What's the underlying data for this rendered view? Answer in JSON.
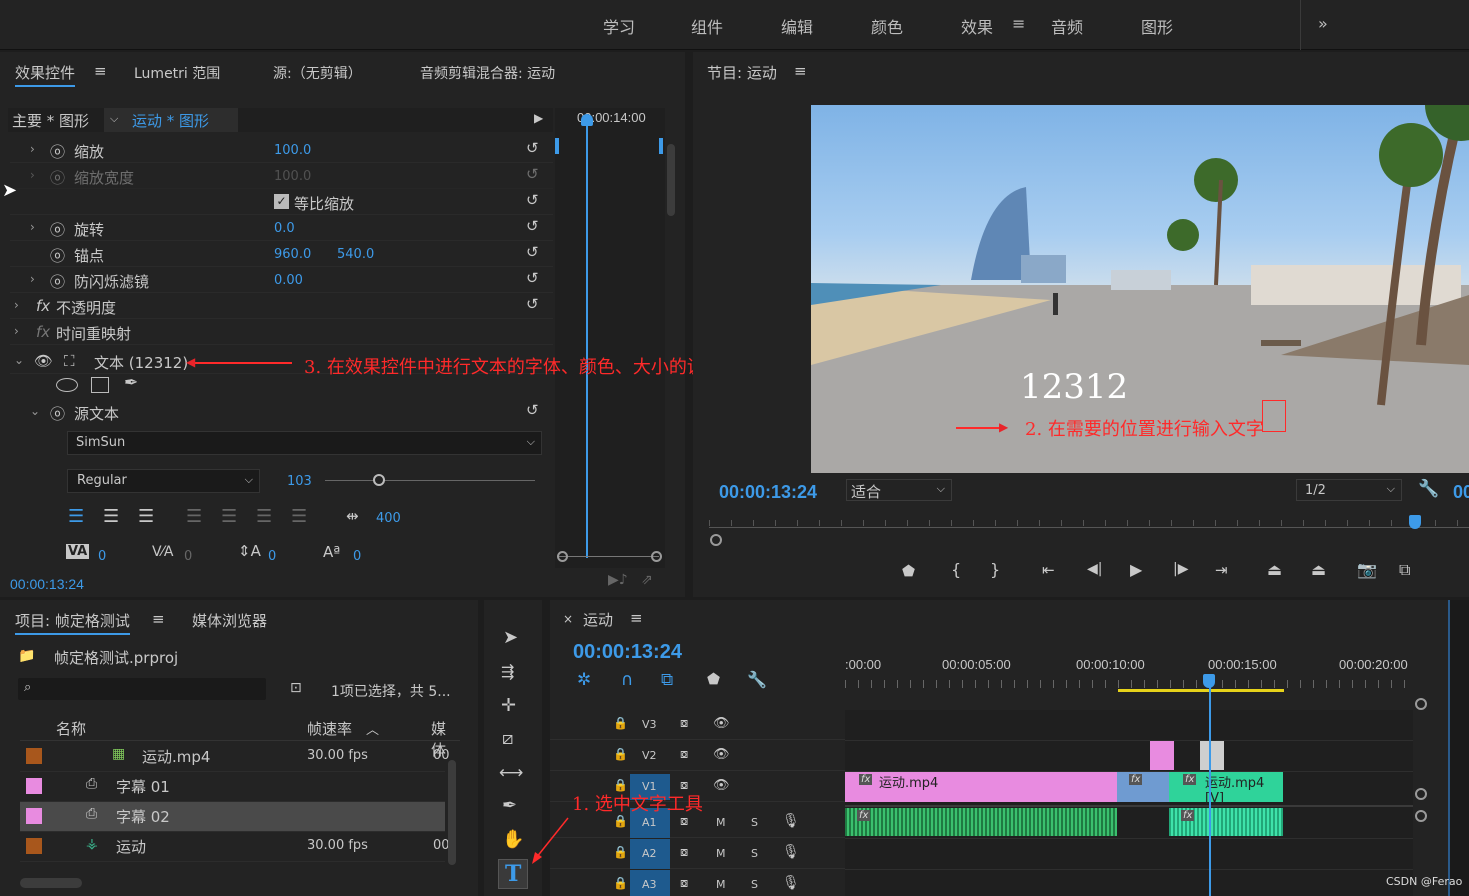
{
  "workspaces": [
    "学习",
    "组件",
    "编辑",
    "颜色",
    "效果",
    "音频",
    "图形"
  ],
  "active_workspace": "效果",
  "effect_controls": {
    "tabs": [
      "效果控件",
      "Lumetri 范围",
      "源:（无剪辑）",
      "音频剪辑混合器: 运动"
    ],
    "breadcrumb_master": "主要 * 图形",
    "breadcrumb_clip": "运动 * 图形",
    "timecode_ruler": "00:00:14:00",
    "rows": [
      {
        "label": "缩放",
        "value": "100.0"
      },
      {
        "label": "缩放宽度",
        "value": "100.0"
      },
      {
        "label": "等比缩放"
      },
      {
        "label": "旋转",
        "value": "0.0"
      },
      {
        "label": "锚点",
        "value": "960.0",
        "value2": "540.0"
      },
      {
        "label": "防闪烁滤镜",
        "value": "0.00"
      },
      {
        "label": "不透明度"
      },
      {
        "label": "时间重映射"
      },
      {
        "label": "文本 (12312)"
      },
      {
        "label": "源文本"
      }
    ],
    "font": "SimSun",
    "style": "Regular",
    "font_size": "103",
    "tracking": "400",
    "kerning": "0",
    "kerning2": "0",
    "leading": "0",
    "baseline": "0",
    "timecode": "00:00:13:24"
  },
  "program": {
    "title": "节目: 运动",
    "video_text": "12312",
    "timecode": "00:00:13:24",
    "fit": "适合",
    "res": "1/2",
    "tc_right": "00"
  },
  "project": {
    "tabs": [
      "项目: 帧定格测试",
      "媒体浏览器"
    ],
    "file": "帧定格测试.prproj",
    "selection": "1项已选择，共 5...",
    "columns": [
      "名称",
      "帧速率",
      "媒体"
    ],
    "items": [
      {
        "name": "运动.mp4",
        "fps": "30.00 fps",
        "media": "00",
        "color": "#a8571c"
      },
      {
        "name": "字幕 01",
        "fps": "",
        "media": "",
        "color": "#e88be0"
      },
      {
        "name": "字幕 02",
        "fps": "",
        "media": "",
        "color": "#e88be0"
      },
      {
        "name": "运动",
        "fps": "30.00 fps",
        "media": "00",
        "color": "#a8571c"
      }
    ]
  },
  "timeline": {
    "title": "运动",
    "timecode": "00:00:13:24",
    "ruler": [
      ":00:00",
      "00:00:05:00",
      "00:00:10:00",
      "00:00:15:00",
      "00:00:20:00"
    ],
    "tracks": [
      "V3",
      "V2",
      "V1",
      "A1",
      "A2",
      "A3"
    ],
    "clip1": "运动.mp4",
    "clip2": "运动.mp4 [V]",
    "fx": "fx",
    "m": "M",
    "s": "S"
  },
  "annotations": {
    "a1": "1. 选中文字工具",
    "a2": "2. 在需要的位置进行输入文字",
    "a3": "3. 在效果控件中进行文本的字体、颜色、大小的调整"
  },
  "watermark": "CSDN @Ferao"
}
